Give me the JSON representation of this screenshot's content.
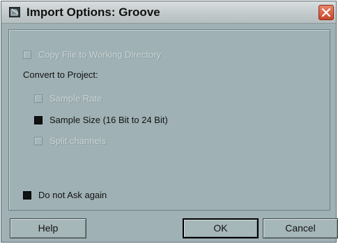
{
  "window": {
    "title": "Import Options: Groove"
  },
  "icons": {
    "app": "dialog-app-icon",
    "close": "close-icon"
  },
  "options": {
    "copy_file": {
      "label": "Copy File to Working Directory",
      "checked": false,
      "enabled": false
    },
    "convert_heading": "Convert to Project:",
    "sample_rate": {
      "label": "Sample Rate",
      "checked": false,
      "enabled": false
    },
    "sample_size": {
      "label": "Sample Size (16 Bit to 24 Bit)",
      "checked": true,
      "enabled": true
    },
    "split_channels": {
      "label": "Split channels",
      "checked": false,
      "enabled": false
    },
    "do_not_ask": {
      "label": "Do not Ask again",
      "checked": true,
      "enabled": true
    }
  },
  "buttons": {
    "help": "Help",
    "ok": "OK",
    "cancel": "Cancel"
  },
  "colors": {
    "dialog_background": "#9fb1b4",
    "close_button": "#c8462b"
  }
}
